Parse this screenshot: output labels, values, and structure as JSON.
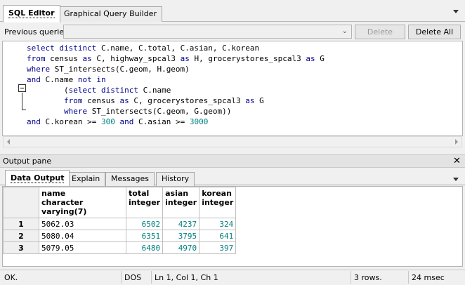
{
  "top_tabs": [
    {
      "label": "SQL Editor",
      "active": true
    },
    {
      "label": "Graphical Query Builder",
      "active": false
    }
  ],
  "toolbar": {
    "previous_queries_label": "Previous queries",
    "previous_queries_value": "",
    "delete_label": "Delete",
    "delete_all_label": "Delete All"
  },
  "editor": {
    "lines": [
      [
        {
          "t": "select distinct C.name, C.total, C.asian, C.korean",
          "c": ""
        }
      ],
      [
        {
          "t": "from census as C, highway_spcal3 as H, grocerystores_spcal3 as G",
          "c": ""
        }
      ],
      [
        {
          "t": "where ST_intersects(C.geom, H.geom)",
          "c": ""
        }
      ],
      [
        {
          "t": "and C.name not in",
          "c": ""
        }
      ],
      [
        {
          "t": "        (select distinct C.name",
          "c": ""
        }
      ],
      [
        {
          "t": "        from census as C, grocerystores_spcal3 as G",
          "c": ""
        }
      ],
      [
        {
          "t": "        where ST_intersects(C.geom, G.geom))",
          "c": ""
        }
      ],
      [
        {
          "t": "and C.korean >= ",
          "c": ""
        },
        {
          "t": "300",
          "c": "num"
        },
        {
          "t": " and C.asian >= ",
          "c": ""
        },
        {
          "t": "3000",
          "c": "num"
        }
      ]
    ]
  },
  "output_pane": {
    "title": "Output pane",
    "tabs": [
      {
        "label": "Data Output",
        "active": true
      },
      {
        "label": "Explain",
        "active": false
      },
      {
        "label": "Messages",
        "active": false
      },
      {
        "label": "History",
        "active": false
      }
    ],
    "columns": [
      {
        "name": "name",
        "type": "character varying(7)"
      },
      {
        "name": "total",
        "type": "integer"
      },
      {
        "name": "asian",
        "type": "integer"
      },
      {
        "name": "korean",
        "type": "integer"
      }
    ],
    "rows": [
      {
        "num": "1",
        "cells": [
          "5062.03",
          "6502",
          "4237",
          "324"
        ]
      },
      {
        "num": "2",
        "cells": [
          "5080.04",
          "6351",
          "3795",
          "641"
        ]
      },
      {
        "num": "3",
        "cells": [
          "5079.05",
          "6480",
          "4970",
          "397"
        ]
      }
    ]
  },
  "status_bar": {
    "status": "OK.",
    "encoding": "DOS",
    "position": "Ln 1, Col 1, Ch 1",
    "rows": "3 rows.",
    "time": "24 msec"
  }
}
